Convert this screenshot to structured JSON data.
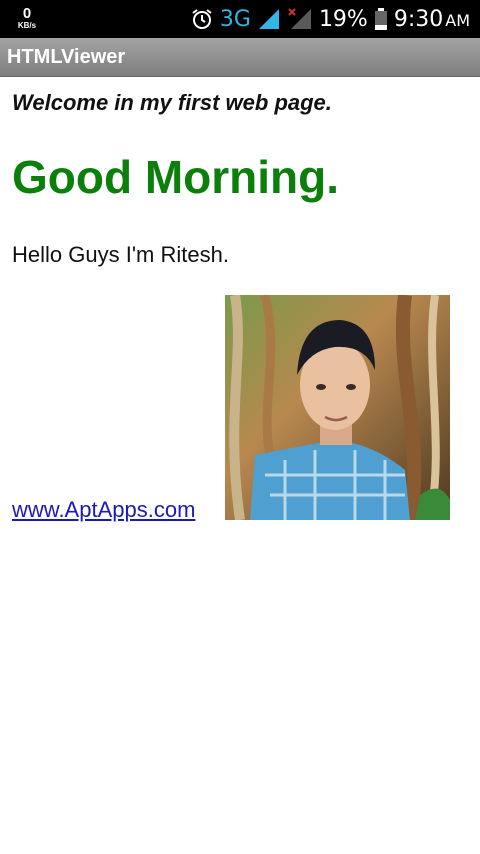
{
  "status_bar": {
    "speed_value": "0",
    "speed_unit": "KB/s",
    "network": "3G",
    "battery": "19%",
    "time": "9:30",
    "ampm": "AM",
    "icons": [
      "alarm-icon",
      "signal-icon",
      "no-signal-icon",
      "battery-icon"
    ]
  },
  "app_bar": {
    "title": "HTMLViewer"
  },
  "page": {
    "welcome": "Welcome in my first web page.",
    "greeting": "Good Morning.",
    "hello": "Hello Guys I'm Ritesh.",
    "link_text": "www.AptApps.com",
    "greeting_color": "#0a7f0a",
    "link_color": "#1a1ab8"
  }
}
